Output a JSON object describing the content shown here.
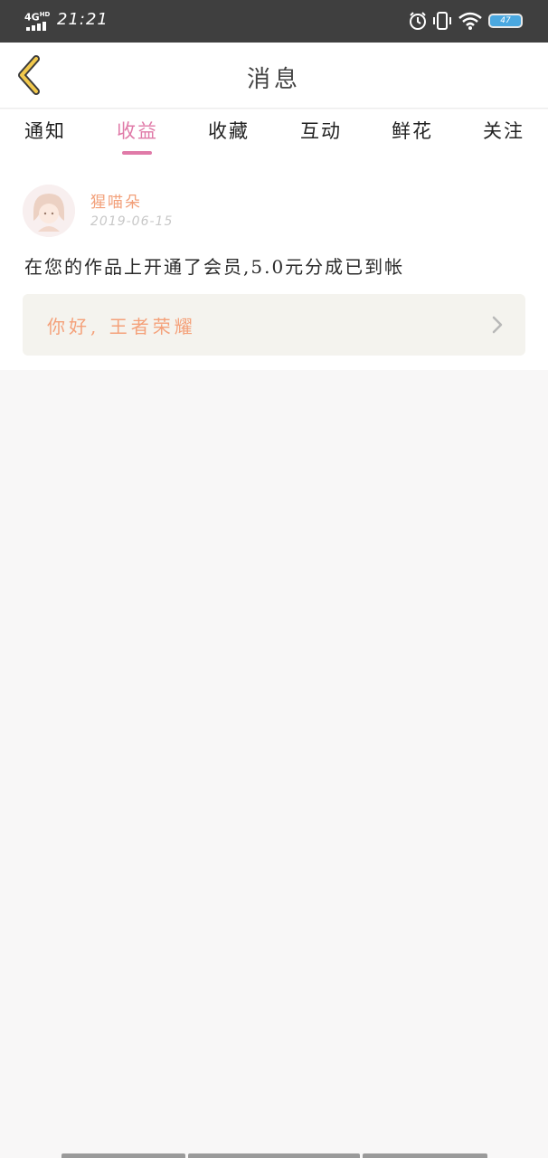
{
  "status_bar": {
    "network": "4G",
    "network_sup": "HD",
    "time": "21:21",
    "battery": "47"
  },
  "header": {
    "title": "消息",
    "back_icon": "chevron-left-icon"
  },
  "tabs": [
    {
      "label": "通知",
      "active": false
    },
    {
      "label": "收益",
      "active": true
    },
    {
      "label": "收藏",
      "active": false
    },
    {
      "label": "互动",
      "active": false
    },
    {
      "label": "鲜花",
      "active": false
    },
    {
      "label": "关注",
      "active": false
    }
  ],
  "message": {
    "sender": "猩喵朵",
    "date": "2019-06-15",
    "body": "在您的作品上开通了会员,5.0元分成已到帐",
    "link_text": "你好, 王者荣耀",
    "link_icon": "chevron-right-icon"
  },
  "colors": {
    "accent": "#e07aa8",
    "sender": "#f2a07a",
    "link_text": "#f4a17a",
    "back_icon": "#f2c94c"
  }
}
